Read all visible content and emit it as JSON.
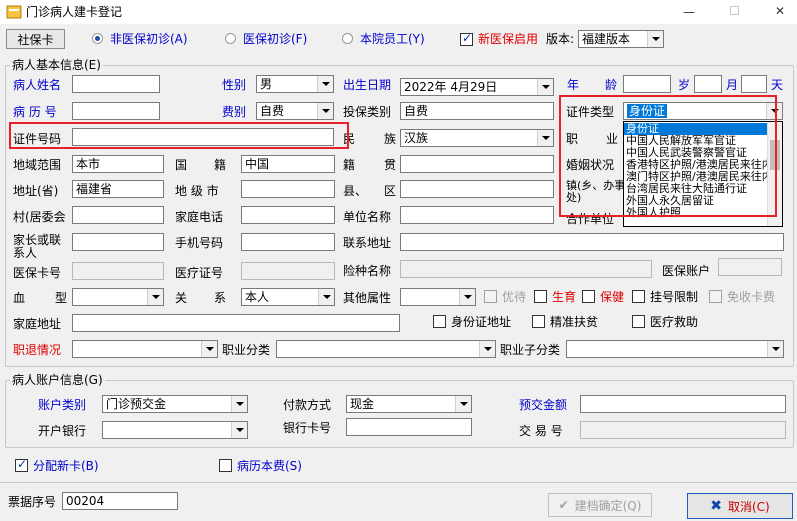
{
  "window": {
    "title": "门诊病人建卡登记",
    "controls": {
      "minimize": "—",
      "maximize": "☐",
      "close": "✕"
    }
  },
  "toolbar": {
    "social_card": "社保卡",
    "radio_non_insured": "非医保初诊(A)",
    "radio_insured": "医保初诊(F)",
    "radio_staff": "本院员工(Y)",
    "new_insurance_enabled": "新医保启用",
    "version_label": "版本:",
    "version_value": "福建版本"
  },
  "basic": {
    "group_title": "病人基本信息(E)",
    "name_label": "病人姓名",
    "gender_label": "性别",
    "gender_value": "男",
    "birth_label": "出生日期",
    "birth_value": "2022年  4月29日",
    "year_label": "年",
    "age_label": "龄",
    "age_year_unit": "岁",
    "age_month_unit": "月",
    "age_day_unit": "天",
    "record_no_label": "病 历 号",
    "fee_type_label": "费别",
    "fee_type_value": "自费",
    "insure_type_label": "投保类别",
    "insure_type_value": "自费",
    "id_type_label": "证件类型",
    "id_type_value": "身份证",
    "id_no_label": "证件号码",
    "ethnic_label": "民",
    "ethnic_label2": "族",
    "ethnic_value": "汉族",
    "occupation_label": "职",
    "occupation_label2": "业",
    "region_label": "地域范围",
    "region_value": "本市",
    "nationality_label": "国",
    "nationality_label2": "籍",
    "nationality_value": "中国",
    "native_label": "籍",
    "native_label2": "贯",
    "marriage_label": "婚姻状况",
    "province_label": "地址(省)",
    "province_value": "福建省",
    "city_label": "地 级 市",
    "county_label": "县、",
    "county_label2": "区",
    "town_label": "镇(乡、办事处)",
    "village_label": "村(居委会",
    "home_phone_label": "家庭电话",
    "employer_label": "单位名称",
    "cooperate_label": "合作单位",
    "guardian_label": "家长或联系人",
    "mobile_label": "手机号码",
    "contact_addr_label": "联系地址",
    "insure_card_label": "医保卡号",
    "medical_cert_label": "医疗证号",
    "insure_name_label": "险种名称",
    "insure_account_label": "医保账户",
    "blood_label": "血",
    "blood_label2": "型",
    "relation_label": "关",
    "relation_label2": "系",
    "relation_value": "本人",
    "other_attr_label": "其他属性",
    "preferential": "优待",
    "birth_check": "生育",
    "health_care": "保健",
    "reg_limit": "挂号限制",
    "free_card_fee": "免收卡费",
    "home_addr_label": "家庭地址",
    "id_addr": "身份证地址",
    "poverty": "精准扶贫",
    "medical_aid": "医疗救助",
    "retire_label": "职退情况",
    "job_category_label": "职业分类",
    "job_sub_label": "职业子分类"
  },
  "id_type_options": [
    "身份证",
    "中国人民解放军军官证",
    "中国人民武装警察警官证",
    "香港特区护照/港澳居民来往内地通行证",
    "澳门特区护照/港澳居民来往内地通行证",
    "台湾居民来往大陆通行证",
    "外国人永久居留证",
    "外国人护照"
  ],
  "account": {
    "group_title": "病人账户信息(G)",
    "acct_type_label": "账户类别",
    "acct_type_value": "门诊预交金",
    "pay_method_label": "付款方式",
    "pay_method_value": "现金",
    "prepay_label": "预交金额",
    "bank_label": "开户银行",
    "bank_card_label": "银行卡号",
    "trans_label": "交 易 号"
  },
  "options": {
    "assign_card": "分配新卡(B)",
    "record_fee": "病历本费(S)"
  },
  "footer": {
    "receipt_label": "票据序号",
    "receipt_value": "00204",
    "confirm": "建档确定(Q)",
    "cancel": "取消(C)"
  },
  "colors": {
    "accent_blue": "#0000cc",
    "accent_red": "#e00000",
    "highlight": "#e8202a"
  }
}
